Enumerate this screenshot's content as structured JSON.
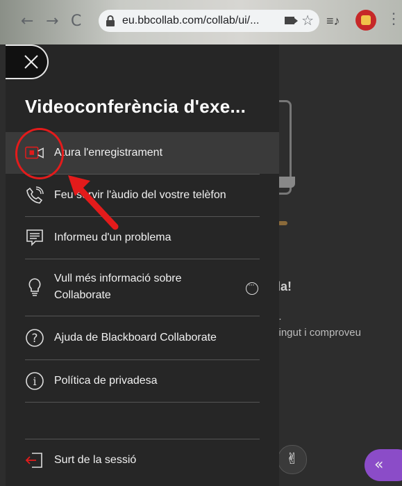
{
  "browser": {
    "url": "eu.bbcollab.com/collab/ui/...",
    "back_icon": "arrow-left-icon",
    "forward_icon": "arrow-right-icon",
    "reload_icon": "reload-icon",
    "back_glyph": "←",
    "forward_glyph": "→",
    "reload_glyph": "C",
    "star_glyph": "☆",
    "kebab_glyph": "⋮",
    "ext1_glyph": "≡♪"
  },
  "background": {
    "title": "da!",
    "line1": "a.",
    "line2": "ntingut i comproveu",
    "hand_glyph": "✌",
    "panel_glyph": "«"
  },
  "menu": {
    "title": "Videoconferència d'exe...",
    "items": [
      {
        "label": "Atura l'enregistrament",
        "icon": "stop-recording-icon"
      },
      {
        "label": "Feu servir l'àudio del vostre telèfon",
        "icon": "phone-icon"
      },
      {
        "label": "Informeu d'un problema",
        "icon": "report-icon"
      },
      {
        "label": "Vull més informació sobre Collaborate",
        "icon": "lightbulb-icon"
      },
      {
        "label": "Ajuda de Blackboard Collaborate",
        "icon": "help-icon"
      },
      {
        "label": "Política de privadesa",
        "icon": "info-icon"
      },
      {
        "label": "Surt de la sessió",
        "icon": "exit-icon"
      }
    ]
  },
  "colors": {
    "accent_red": "#e31b1b",
    "panel_purple": "#8b4cc8"
  }
}
